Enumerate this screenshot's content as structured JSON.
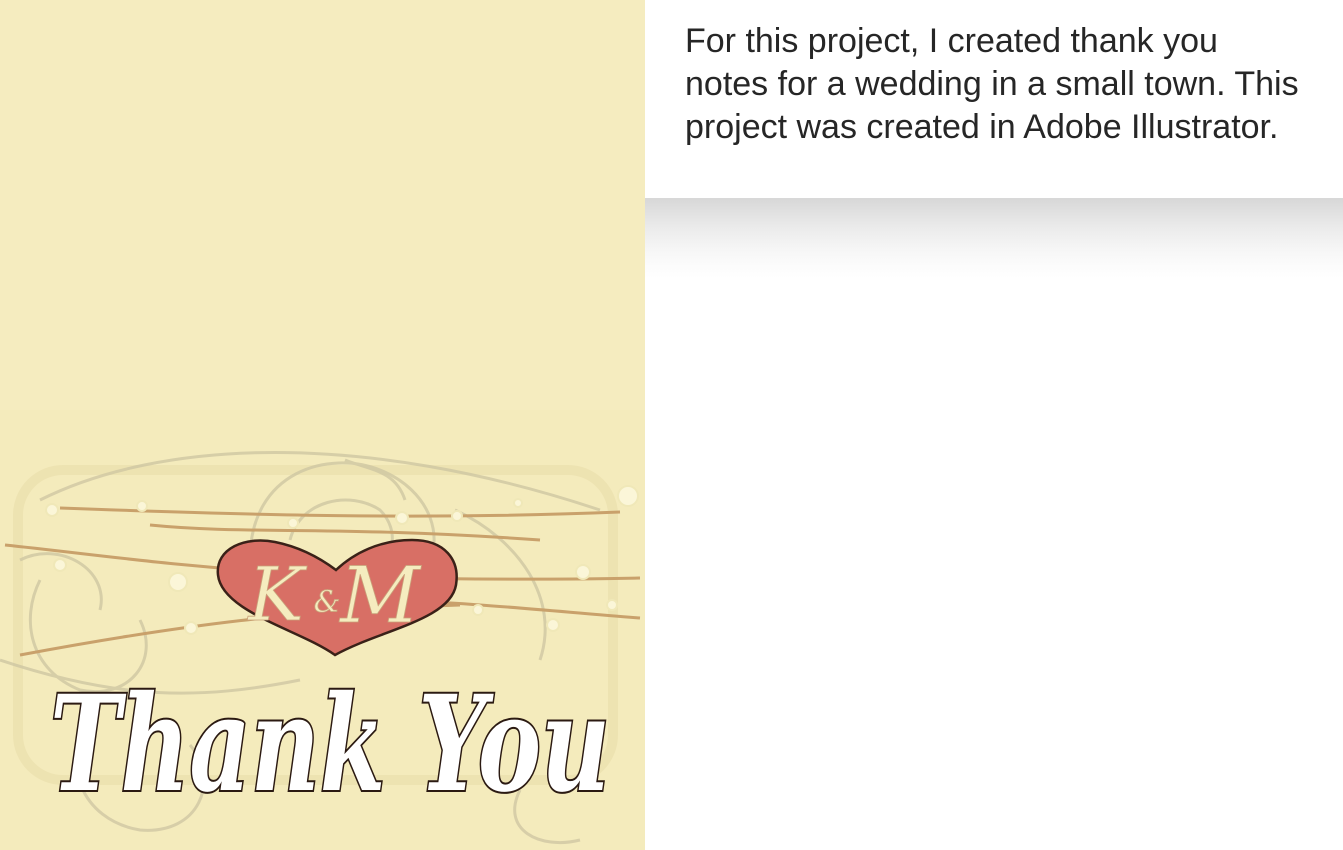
{
  "card": {
    "monogram_left": "K",
    "monogram_amp": "&",
    "monogram_right": "M",
    "greeting": "Thank You",
    "background_color": "#f5ecbf",
    "heart_color": "#d86f65",
    "outline_color": "#2b1a12"
  },
  "description": {
    "text": "For this project, I created thank you notes for a wedding in a small town. This project was created in Adobe Illustrator."
  }
}
